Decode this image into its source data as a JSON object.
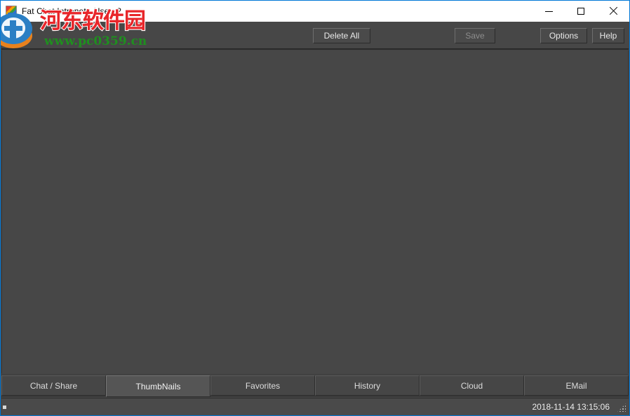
{
  "window": {
    "title": "Fat Chat Intranet - User: 2",
    "app_icon": "app-icon",
    "accent_color": "#0078d7",
    "content_bg": "#474747"
  },
  "window_controls": {
    "minimize": "minimize-icon",
    "maximize": "maximize-icon",
    "close": "close-icon"
  },
  "toolbar": {
    "delete_all_label": "Delete All",
    "save_label": "Save",
    "save_enabled": false,
    "options_label": "Options",
    "help_label": "Help"
  },
  "content": {
    "body_text": ""
  },
  "tabs": [
    {
      "label": "Chat / Share",
      "active": false
    },
    {
      "label": "ThumbNails",
      "active": true
    },
    {
      "label": "Favorites",
      "active": false
    },
    {
      "label": "History",
      "active": false
    },
    {
      "label": "Cloud",
      "active": false
    },
    {
      "label": "EMail",
      "active": false
    }
  ],
  "statusbar": {
    "left_text": "",
    "timestamp": "2018-11-14 13:15:06",
    "grip": "resize-grip-icon"
  },
  "watermark": {
    "site_name_cn": "河东软件园",
    "url": "www.pc0359.cn",
    "cn_color": "#e8262a",
    "url_color": "#1f8f1f"
  }
}
